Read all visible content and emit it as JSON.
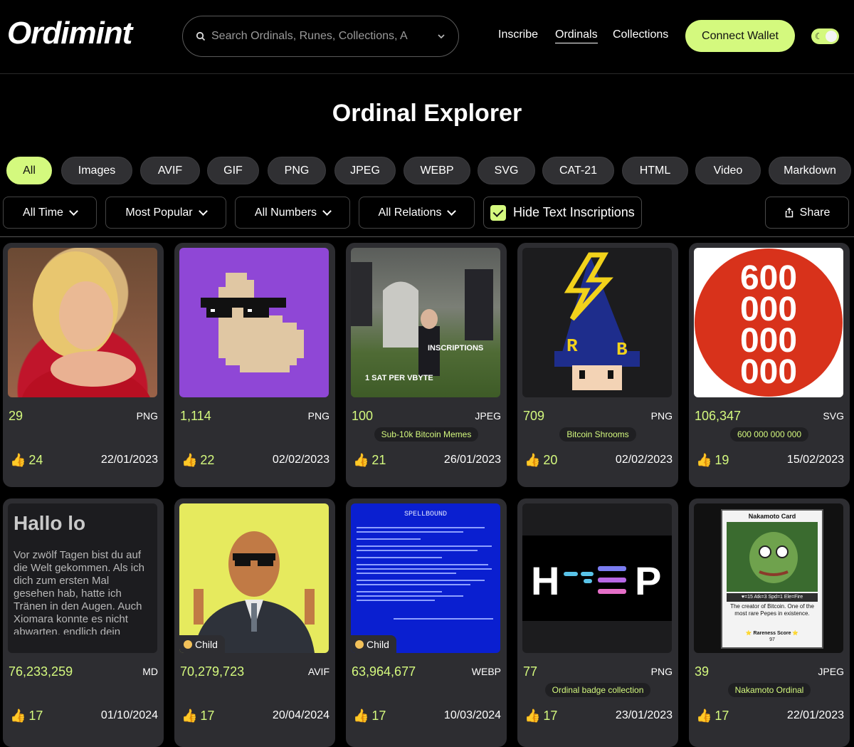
{
  "header": {
    "logo": "Ordimint",
    "search_placeholder": "Search Ordinals, Runes, Collections, A",
    "nav": [
      "Inscribe",
      "Ordinals",
      "Collections"
    ],
    "active_nav": "Ordinals",
    "connect_label": "Connect Wallet"
  },
  "page_title": "Ordinal Explorer",
  "filters": [
    "All",
    "Images",
    "AVIF",
    "GIF",
    "PNG",
    "JPEG",
    "WEBP",
    "SVG",
    "CAT-21",
    "HTML",
    "Video",
    "Markdown"
  ],
  "active_filter": "All",
  "dropdowns": {
    "time": "All Time",
    "sort": "Most Popular",
    "numbers": "All Numbers",
    "relations": "All Relations"
  },
  "hide_text_label": "Hide Text Inscriptions",
  "hide_text_checked": true,
  "share_label": "Share",
  "colors": {
    "accent": "#d4f97e",
    "card": "#2d2d31",
    "background": "#000000"
  },
  "cards": [
    {
      "number": "29",
      "type": "PNG",
      "collection": "",
      "likes": "24",
      "date": "22/01/2023"
    },
    {
      "number": "1,114",
      "type": "PNG",
      "collection": "",
      "likes": "22",
      "date": "02/02/2023"
    },
    {
      "number": "100",
      "type": "JPEG",
      "collection": "Sub-10k Bitcoin Memes",
      "likes": "21",
      "date": "26/01/2023",
      "thumb_text": [
        "INSCRIPTIONS",
        "1 SAT PER VBYTE"
      ]
    },
    {
      "number": "709",
      "type": "PNG",
      "collection": "Bitcoin Shrooms",
      "likes": "20",
      "date": "02/02/2023",
      "thumb_text": [
        "R",
        "B"
      ]
    },
    {
      "number": "106,347",
      "type": "SVG",
      "collection": "600 000 000 000",
      "likes": "19",
      "date": "15/02/2023",
      "thumb_text": [
        "600",
        "000",
        "000",
        "000"
      ]
    },
    {
      "number": "76,233,259",
      "type": "MD",
      "collection": "",
      "likes": "17",
      "date": "01/10/2024",
      "thumb_title": "Hallo lo",
      "thumb_body": "Vor zwölf Tagen bist du auf die Welt gekommen. Als ich dich zum ersten Mal gesehen hab, hatte ich Tränen in den Augen. Auch Xiomara konnte es nicht abwarten, endlich dein Schreien zu hören"
    },
    {
      "number": "70,279,723",
      "type": "AVIF",
      "collection": "",
      "likes": "17",
      "date": "20/04/2024",
      "badge": "Child"
    },
    {
      "number": "63,964,677",
      "type": "WEBP",
      "collection": "",
      "likes": "17",
      "date": "10/03/2024",
      "badge": "Child",
      "thumb_title": "SPELLBOUND"
    },
    {
      "number": "77",
      "type": "PNG",
      "collection": "Ordinal badge collection",
      "likes": "17",
      "date": "23/01/2023",
      "thumb_text": [
        "H",
        "P"
      ]
    },
    {
      "number": "39",
      "type": "JPEG",
      "collection": "Nakamoto Ordinal",
      "likes": "17",
      "date": "22/01/2023",
      "thumb_title": "Nakamoto Card",
      "thumb_stats": "♥=15  Atk=3  Spd=1  Ele=Fire",
      "thumb_body": "The creator of Bitcoin. One of the most rare Pepes in existence.",
      "thumb_score": "⭐ Rareness Score ⭐",
      "thumb_score_value": "97"
    }
  ]
}
